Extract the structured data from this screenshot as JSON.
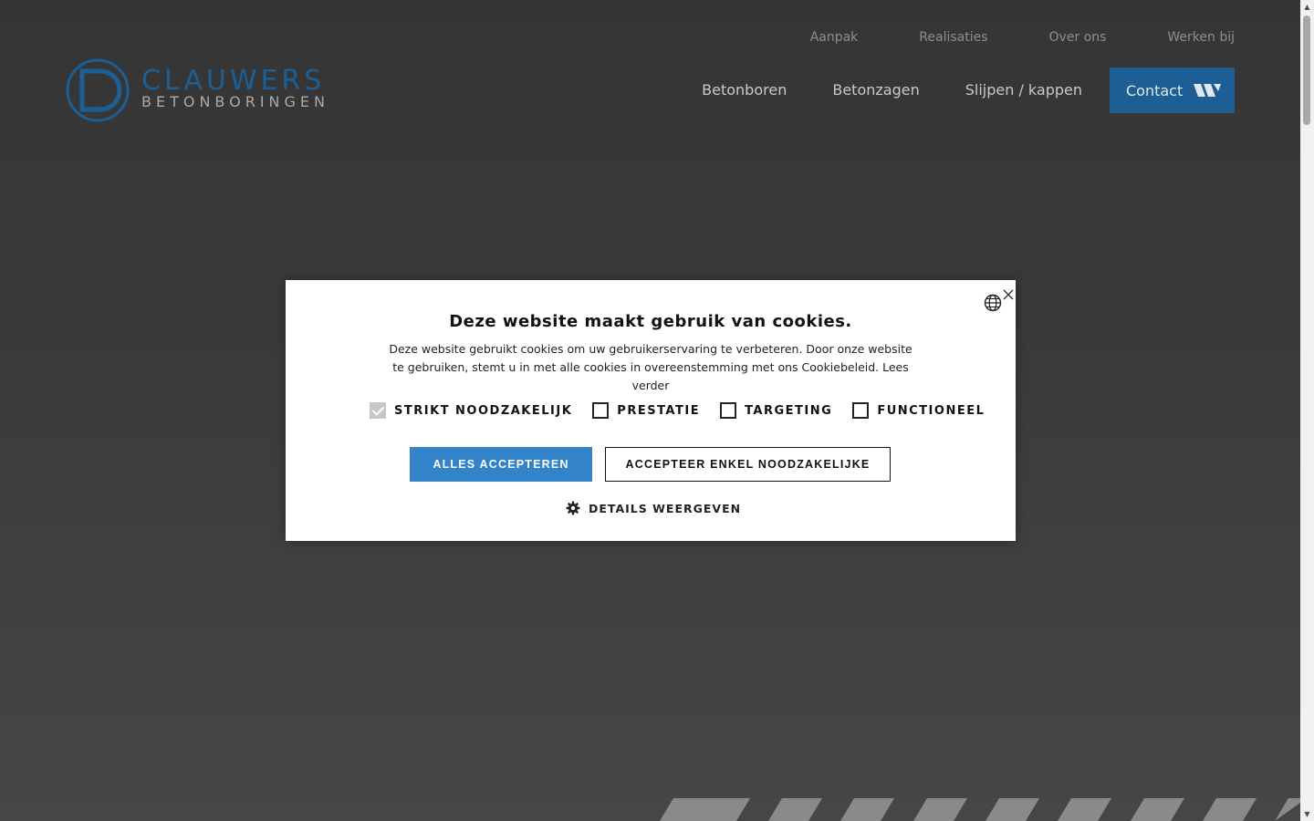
{
  "header": {
    "top_nav": [
      "Aanpak",
      "Realisaties",
      "Over ons",
      "Werken bij"
    ],
    "main_nav": [
      "Betonboren",
      "Betonzagen",
      "Slijpen / kappen"
    ],
    "contact_label": "Contact",
    "logo": {
      "line1": "CLAUWERS",
      "line2": "BETONBORINGEN"
    }
  },
  "cookie_modal": {
    "title": "Deze website maakt gebruik van cookies.",
    "description": "Deze website gebruikt cookies om uw gebruikerservaring te verbeteren. Door onze website te gebruiken, stemt u in met alle cookies in overeenstemming met ons Cookiebeleid. Lees verder",
    "checkboxes": [
      {
        "label": "STRIKT NOODZAKELIJK",
        "checked": true,
        "disabled": true
      },
      {
        "label": "PRESTATIE",
        "checked": false
      },
      {
        "label": "TARGETING",
        "checked": false
      },
      {
        "label": "FUNCTIONEEL",
        "checked": false
      }
    ],
    "accept_all_label": "ALLES ACCEPTEREN",
    "accept_necessary_label": "ACCEPTEER ENKEL NOODZAKELIJKE",
    "details_label": "DETAILS WEERGEVEN"
  },
  "colors": {
    "brand_blue": "#1d5f95",
    "accept_blue": "#3283c8",
    "background": "#3a3a3a"
  }
}
